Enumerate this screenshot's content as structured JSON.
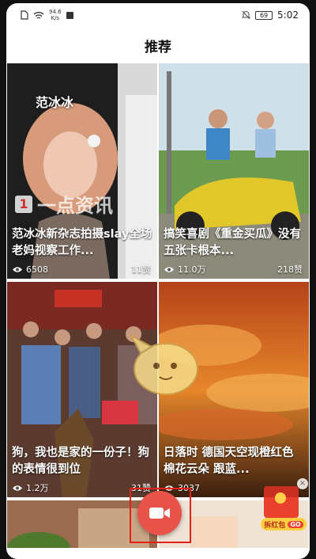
{
  "status_bar": {
    "network_speed": "94.6",
    "network_unit": "K/s",
    "battery": "69",
    "time": "5:02"
  },
  "header": {
    "title": "推荐"
  },
  "feed": {
    "cards": [
      {
        "overlay": "范冰冰",
        "watermark": "一点资讯",
        "watermark_badge": "1",
        "caption": "范冰冰新杂志拍摄slay全场 老妈视察工作...",
        "views": "6508",
        "likes": "11赞"
      },
      {
        "caption": "搞笑喜剧《重金买瓜》没有五张卡根本...",
        "views": "11.0万",
        "likes": "218赞"
      },
      {
        "caption": "狗，我也是家的一份子！狗的表情很到位",
        "views": "1.2万",
        "likes": "31赞"
      },
      {
        "caption": "日落时 德国天空现橙红色棉花云朵 跟蓝...",
        "views": "3037",
        "likes": ""
      }
    ]
  },
  "red_packet": {
    "label": "拆红包",
    "go": "GO"
  },
  "colors": {
    "camera_button": "#e8534a",
    "highlight_border": "#e2231a",
    "red_packet": "#e9412e"
  }
}
